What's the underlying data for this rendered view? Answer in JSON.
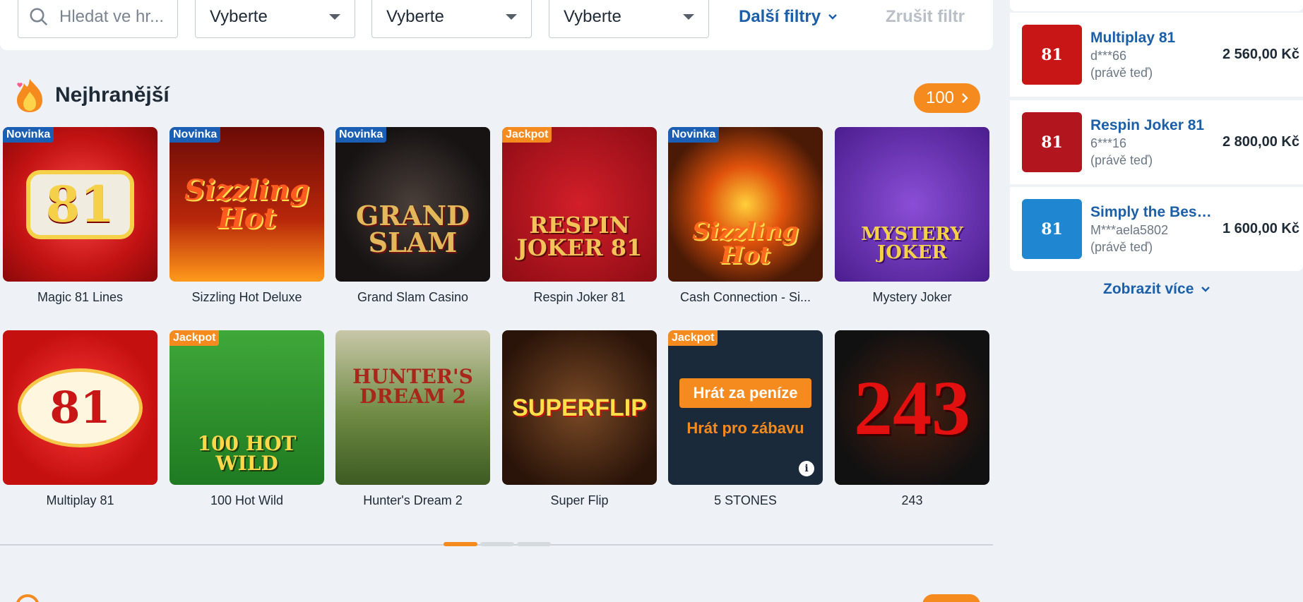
{
  "filters": {
    "search_placeholder": "Hledat ve hr...",
    "selects": [
      "Vyberte",
      "Vyberte",
      "Vyberte"
    ],
    "more_filters": "Další filtry",
    "clear_filter": "Zrušit filtr"
  },
  "section": {
    "title": "Nejhranější",
    "count": "100"
  },
  "games": [
    {
      "name": "Magic 81 Lines",
      "badge": "Novinka",
      "art": "81"
    },
    {
      "name": "Sizzling Hot Deluxe",
      "badge": "Novinka",
      "art": "Sizzling Hot"
    },
    {
      "name": "Grand Slam Casino",
      "badge": "Novinka",
      "art": "GRAND SLAM"
    },
    {
      "name": "Respin Joker 81",
      "badge": "Jackpot",
      "art": "RESPIN JOKER 81"
    },
    {
      "name": "Cash Connection - Si...",
      "badge": "Novinka",
      "art": "Sizzling Hot"
    },
    {
      "name": "Mystery Joker",
      "badge": "",
      "art": "MYSTERY JOKER"
    },
    {
      "name": "Multiplay 81",
      "badge": "",
      "art": "81"
    },
    {
      "name": "100 Hot Wild",
      "badge": "Jackpot",
      "art": "100 HOT WILD"
    },
    {
      "name": "Hunter's Dream 2",
      "badge": "",
      "art": "HUNTER'S DREAM 2"
    },
    {
      "name": "Super Flip",
      "badge": "",
      "art": "SUPERFLIP"
    },
    {
      "name": "5 STONES",
      "badge": "Jackpot",
      "play_money": "Hrát za peníze",
      "play_fun": "Hrát pro zábavu"
    },
    {
      "name": "243",
      "badge": "",
      "art": "243"
    }
  ],
  "winners": [
    {
      "game": "Multiplay 81",
      "user": "d***66",
      "time": "(právě teď)",
      "amount": "2 560,00 Kč",
      "art": "81",
      "color": "#c81616"
    },
    {
      "game": "Respin Joker 81",
      "user": "6***16",
      "time": "(právě teď)",
      "amount": "2 800,00 Kč",
      "art": "81",
      "color": "#b3151f"
    },
    {
      "game": "Simply the Best...",
      "user": "M***aela5802",
      "time": "(právě teď)",
      "amount": "1 600,00 Kč",
      "art": "81",
      "color": "#1f86d1"
    }
  ],
  "show_more": "Zobrazit více",
  "colors": {
    "accent": "#f58a1f",
    "link": "#1b5fa8",
    "badge_new": "#1a5fb4"
  }
}
